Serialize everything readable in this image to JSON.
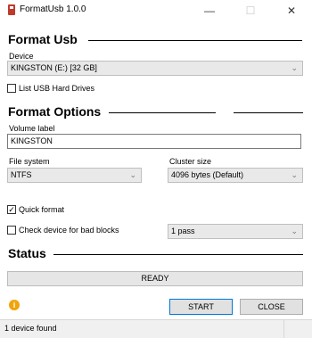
{
  "window": {
    "title": "FormatUsb 1.0.0",
    "minimize_glyph": "—",
    "maximize_glyph": "☐",
    "close_glyph": "✕",
    "icon": "usb-app-icon",
    "icon_color": "#c0392b"
  },
  "format_usb": {
    "heading": "Format Usb",
    "device_label": "Device",
    "device_value": "KINGSTON (E:) [32 GB]",
    "list_usb_hard_drives_label": "List USB Hard Drives",
    "list_usb_hard_drives_checked": false
  },
  "format_options": {
    "heading": "Format Options",
    "volume_label_label": "Volume label",
    "volume_label_value": "KINGSTON",
    "file_system_label": "File system",
    "file_system_value": "NTFS",
    "cluster_size_label": "Cluster size",
    "cluster_size_value": "4096 bytes (Default)",
    "quick_format_label": "Quick format",
    "quick_format_checked": true,
    "check_bad_blocks_label": "Check device for bad blocks",
    "check_bad_blocks_checked": false,
    "passes_value": "1 pass",
    "check_mark": "✓"
  },
  "status": {
    "heading": "Status",
    "progress_text": "READY",
    "progress_percent": 0,
    "progress_color": "#06b025"
  },
  "actions": {
    "info_icon": "info-icon",
    "info_glyph": "i",
    "start_label": "START",
    "close_label": "CLOSE"
  },
  "statusbar": {
    "text": "1 device found"
  },
  "chevron_glyph": "⌄"
}
